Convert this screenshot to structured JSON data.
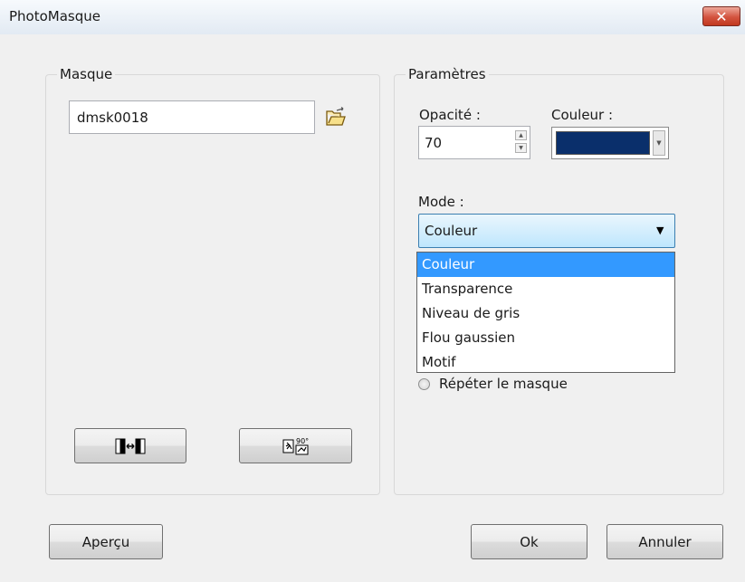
{
  "window": {
    "title": "PhotoMasque",
    "close_glyph": "✕"
  },
  "mask_group": {
    "legend": "Masque",
    "mask_name_value": "dmsk0018"
  },
  "params_group": {
    "legend": "Paramètres",
    "opacity_label": "Opacité :",
    "opacity_value": "70",
    "color_label": "Couleur :",
    "color_value": "#0a2f6b",
    "mode_label": "Mode :",
    "mode_selected": "Couleur",
    "mode_options": [
      "Couleur",
      "Transparence",
      "Niveau de gris",
      "Flou gaussien",
      "Motif"
    ],
    "repeat_mask_label": "Répéter le masque"
  },
  "buttons": {
    "preview": "Aperçu",
    "ok": "Ok",
    "cancel": "Annuler"
  },
  "icons": {
    "open_folder": "open-folder-icon",
    "flip": "flip-horizontal-icon",
    "rotate": "rotate-90-icon"
  }
}
